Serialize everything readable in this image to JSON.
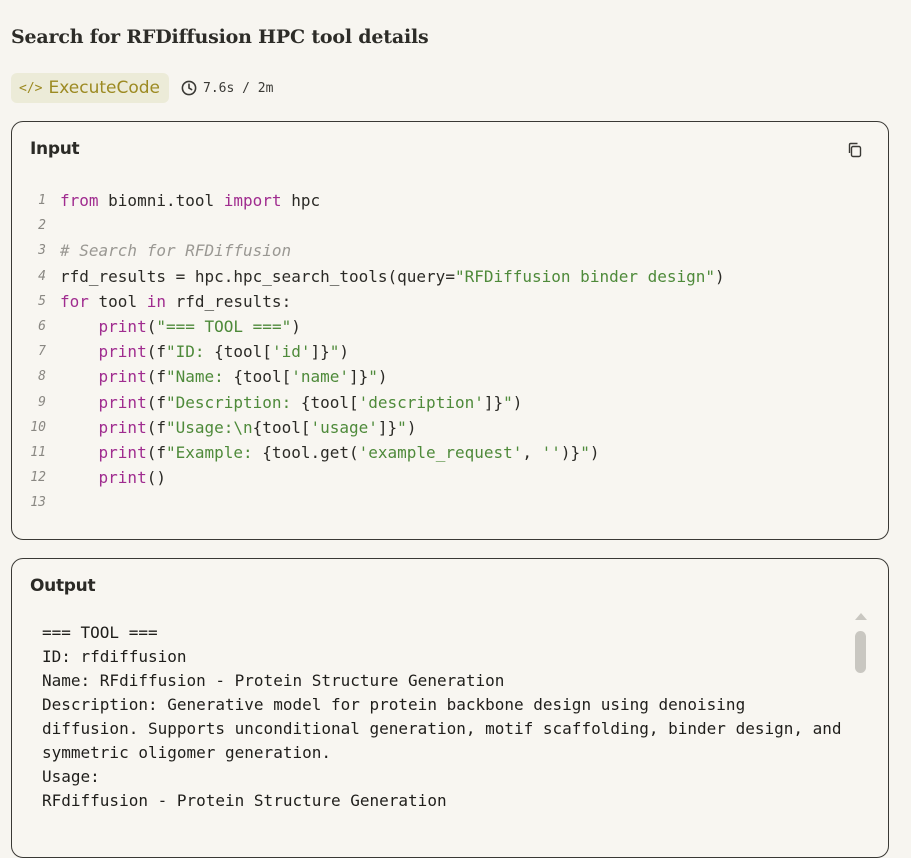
{
  "header": {
    "title": "Search for RFDiffusion HPC tool details",
    "badge_label": "ExecuteCode",
    "timer": "7.6s / 2m"
  },
  "input_panel": {
    "title": "Input",
    "lines": [
      {
        "n": "1"
      },
      {
        "n": "2"
      },
      {
        "n": "3"
      },
      {
        "n": "4"
      },
      {
        "n": "5"
      },
      {
        "n": "6"
      },
      {
        "n": "7"
      },
      {
        "n": "8"
      },
      {
        "n": "9"
      },
      {
        "n": "10"
      },
      {
        "n": "11"
      },
      {
        "n": "12"
      },
      {
        "n": "13"
      }
    ],
    "code": {
      "l1_from": "from",
      "l1_mod": " biomni.tool ",
      "l1_import": "import",
      "l1_name": " hpc",
      "l3_comment": "# Search for RFDiffusion",
      "l4_pre": "rfd_results = hpc.hpc_search_tools(query=",
      "l4_str": "\"RFDiffusion binder design\"",
      "l4_post": ")",
      "l5_for": "for",
      "l5_mid": " tool ",
      "l5_in": "in",
      "l5_post": " rfd_results:",
      "l6_print": "print",
      "l6_open": "(",
      "l6_str": "\"=== TOOL ===\"",
      "l6_close": ")",
      "l7_print": "print",
      "l7_a": "(f",
      "l7_s1": "\"ID: ",
      "l7_b": "{tool[",
      "l7_s2": "'id'",
      "l7_c": "]}",
      "l7_s3": "\"",
      "l7_d": ")",
      "l8_print": "print",
      "l8_a": "(f",
      "l8_s1": "\"Name: ",
      "l8_b": "{tool[",
      "l8_s2": "'name'",
      "l8_c": "]}",
      "l8_s3": "\"",
      "l8_d": ")",
      "l9_print": "print",
      "l9_a": "(f",
      "l9_s1": "\"Description: ",
      "l9_b": "{tool[",
      "l9_s2": "'description'",
      "l9_c": "]}",
      "l9_s3": "\"",
      "l9_d": ")",
      "l10_print": "print",
      "l10_a": "(f",
      "l10_s1": "\"Usage:\\n",
      "l10_b": "{tool[",
      "l10_s2": "'usage'",
      "l10_c": "]}",
      "l10_s3": "\"",
      "l10_d": ")",
      "l11_print": "print",
      "l11_a": "(f",
      "l11_s1": "\"Example: ",
      "l11_b": "{tool.get(",
      "l11_s2": "'example_request'",
      "l11_c": ", ",
      "l11_s4": "''",
      "l11_e": ")}",
      "l11_s3": "\"",
      "l11_d": ")",
      "l12_print": "print",
      "l12_a": "()"
    }
  },
  "output_panel": {
    "title": "Output",
    "text": "=== TOOL ===\nID: rfdiffusion\nName: RFdiffusion - Protein Structure Generation\nDescription: Generative model for protein backbone design using denoising diffusion. Supports unconditional generation, motif scaffolding, binder design, and symmetric oligomer generation.\nUsage:\nRFdiffusion - Protein Structure Generation"
  },
  "colors": {
    "badge_text": "#9c8a22",
    "keyword": "#a02c8f",
    "string": "#4e8a3a"
  }
}
